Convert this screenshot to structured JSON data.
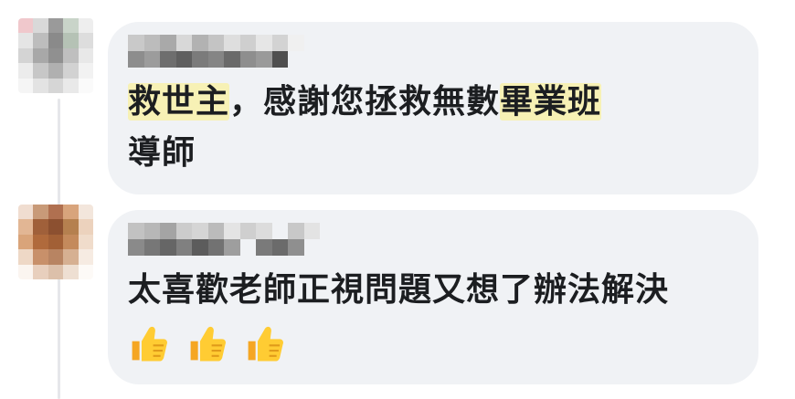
{
  "comments": [
    {
      "author_blurred": true,
      "text_parts": [
        "救世主",
        "，感謝您拯救無數",
        "畢業班",
        "導師"
      ],
      "highlighted_parts": [
        "救世主",
        "畢業班"
      ]
    },
    {
      "author_blurred": true,
      "text_parts": [
        "太喜歡老師正視問題又想了辦法解決"
      ],
      "emoji": [
        "thumbs-up",
        "thumbs-up",
        "thumbs-up"
      ]
    }
  ],
  "colors": {
    "bubble": "#f0f2f5",
    "text": "#1c1e21",
    "highlight": "#f7f1b5",
    "thread_line": "#e6e7ea"
  }
}
